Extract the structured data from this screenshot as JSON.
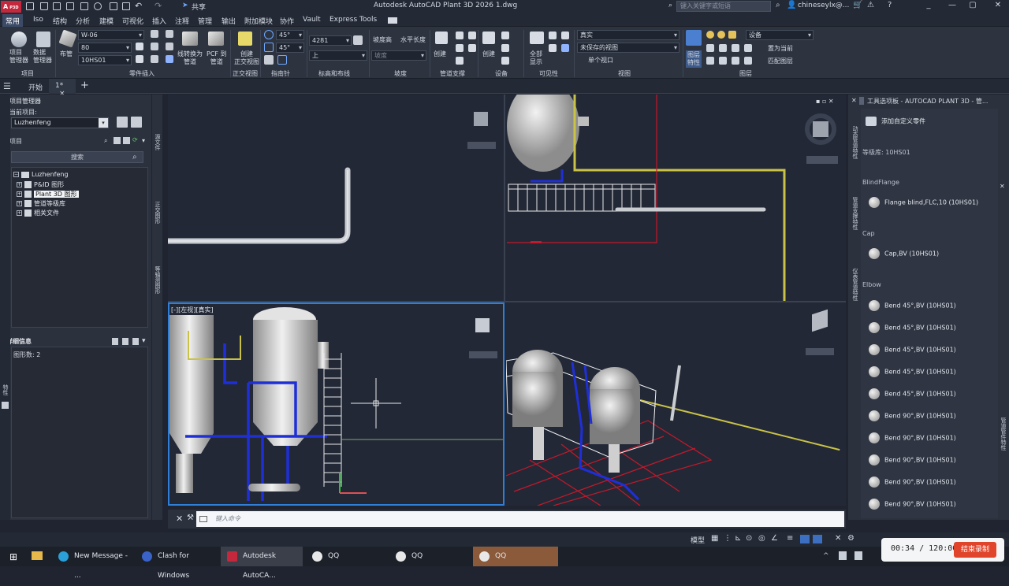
{
  "titlebar": {
    "logo": "A",
    "logo_sub": "P3D",
    "share": "共享",
    "title": "Autodesk AutoCAD Plant 3D 2026    1.dwg",
    "search_placeholder": "键入关键字或短语",
    "user": "chineseylx@..."
  },
  "menu_tabs": [
    "常用",
    "Iso",
    "结构",
    "分析",
    "建模",
    "可视化",
    "插入",
    "注释",
    "管理",
    "输出",
    "附加模块",
    "协作",
    "Vault",
    "Express Tools"
  ],
  "ribbon": {
    "project_btn": "项目\n管理器",
    "data_mgr_btn": "数据\n管理器",
    "group_project": "项目",
    "route_pipe": "布管",
    "spec_combo": "W-06",
    "size_combo": "80",
    "spec2_combo": "10HS01",
    "line_to_pipe": "线转换为\n管道",
    "pcf_to_pipe": "PCF 到\n管道",
    "group_parts": "零件插入",
    "create_ortho": "创建\n正交视图",
    "group_ortho": "正交视图",
    "angle1": "45°",
    "angle2": "45°",
    "group_compass": "指南针",
    "elev_value": "4281",
    "elev_combo": "上",
    "group_elev": "标高和布线",
    "slope_label": "坡度高",
    "slope_label2": "水平长度",
    "slope_input": "坡度",
    "group_slope": "坡度",
    "create1": "创建",
    "group_support": "管道支撑",
    "create2": "创建",
    "group_equipment": "设备",
    "show_all": "全部\n显示",
    "group_visibility": "可见性",
    "visual_style": "真实",
    "saved_view": "未保存的视图",
    "single_viewport": "单个视口",
    "group_view": "视图",
    "layer_props": "图层\n特性",
    "layer_combo": "设备",
    "set_current": "置为当前",
    "match_layer": "匹配图层",
    "group_layers": "图层"
  },
  "doc_tabs": [
    "开始",
    "1*"
  ],
  "project_manager": {
    "title": "项目管理器",
    "current_label": "当前项目:",
    "project_name": "Luzhenfeng",
    "tree_header": "项目",
    "search_btn": "搜索",
    "tree": [
      {
        "label": "Luzhenfeng",
        "level": 0,
        "exp": "−"
      },
      {
        "label": "P&ID 图形",
        "level": 1,
        "exp": "+"
      },
      {
        "label": "Plant 3D 图形",
        "level": 1,
        "exp": "+",
        "selected": true
      },
      {
        "label": "管道等级库",
        "level": 1,
        "exp": "+"
      },
      {
        "label": "相关文件",
        "level": 1,
        "exp": "+"
      }
    ],
    "detail_title": "详细信息",
    "detail_text": "图形数: 2"
  },
  "side_tabs": {
    "left_strip": [
      "源文件",
      "正交图形",
      "等轴测图形"
    ],
    "left_outer": "特性",
    "right_strip": [
      "动态管道特性",
      "管道支撑特性",
      "仪表管道特性"
    ],
    "right_outer": "管道管件特性"
  },
  "viewports": {
    "bottom_left_label": "[-][左视][真实]"
  },
  "command": {
    "placeholder": "键入命令"
  },
  "palette": {
    "title": "工具选项板 - AUTOCAD PLANT 3D - 管...",
    "add_custom": "添加自定义零件",
    "spec_label": "等级库: 10HS01",
    "sections": [
      {
        "name": "BlindFlange",
        "items": [
          "Flange blind,FLC,10 (10HS01)"
        ]
      },
      {
        "name": "Cap",
        "items": [
          "Cap,BV (10HS01)"
        ]
      },
      {
        "name": "Elbow",
        "items": [
          "Bend 45°,BV (10HS01)",
          "Bend 45°,BV (10HS01)",
          "Bend 45°,BV (10HS01)",
          "Bend 45°,BV (10HS01)",
          "Bend 45°,BV (10HS01)",
          "Bend 90°,BV (10HS01)",
          "Bend 90°,BV (10HS01)",
          "Bend 90°,BV (10HS01)",
          "Bend 90°,BV (10HS01)",
          "Bend 90°,BV (10HS01)"
        ]
      }
    ]
  },
  "statusbar": {
    "model": "模型"
  },
  "taskbar": {
    "tasks": [
      "New Message - ...",
      "Clash for Windows",
      "Autodesk AutoCA...",
      "QQ",
      "QQ",
      "QQ"
    ],
    "rec_time": "00:34 / 120:00",
    "rec_button": "结束录制"
  },
  "colors": {
    "pipe_blue": "#1f2fd8",
    "pipe_yellow": "#c9c247",
    "grid_red": "#c4192b",
    "accent_blue": "#2f7fd8"
  }
}
